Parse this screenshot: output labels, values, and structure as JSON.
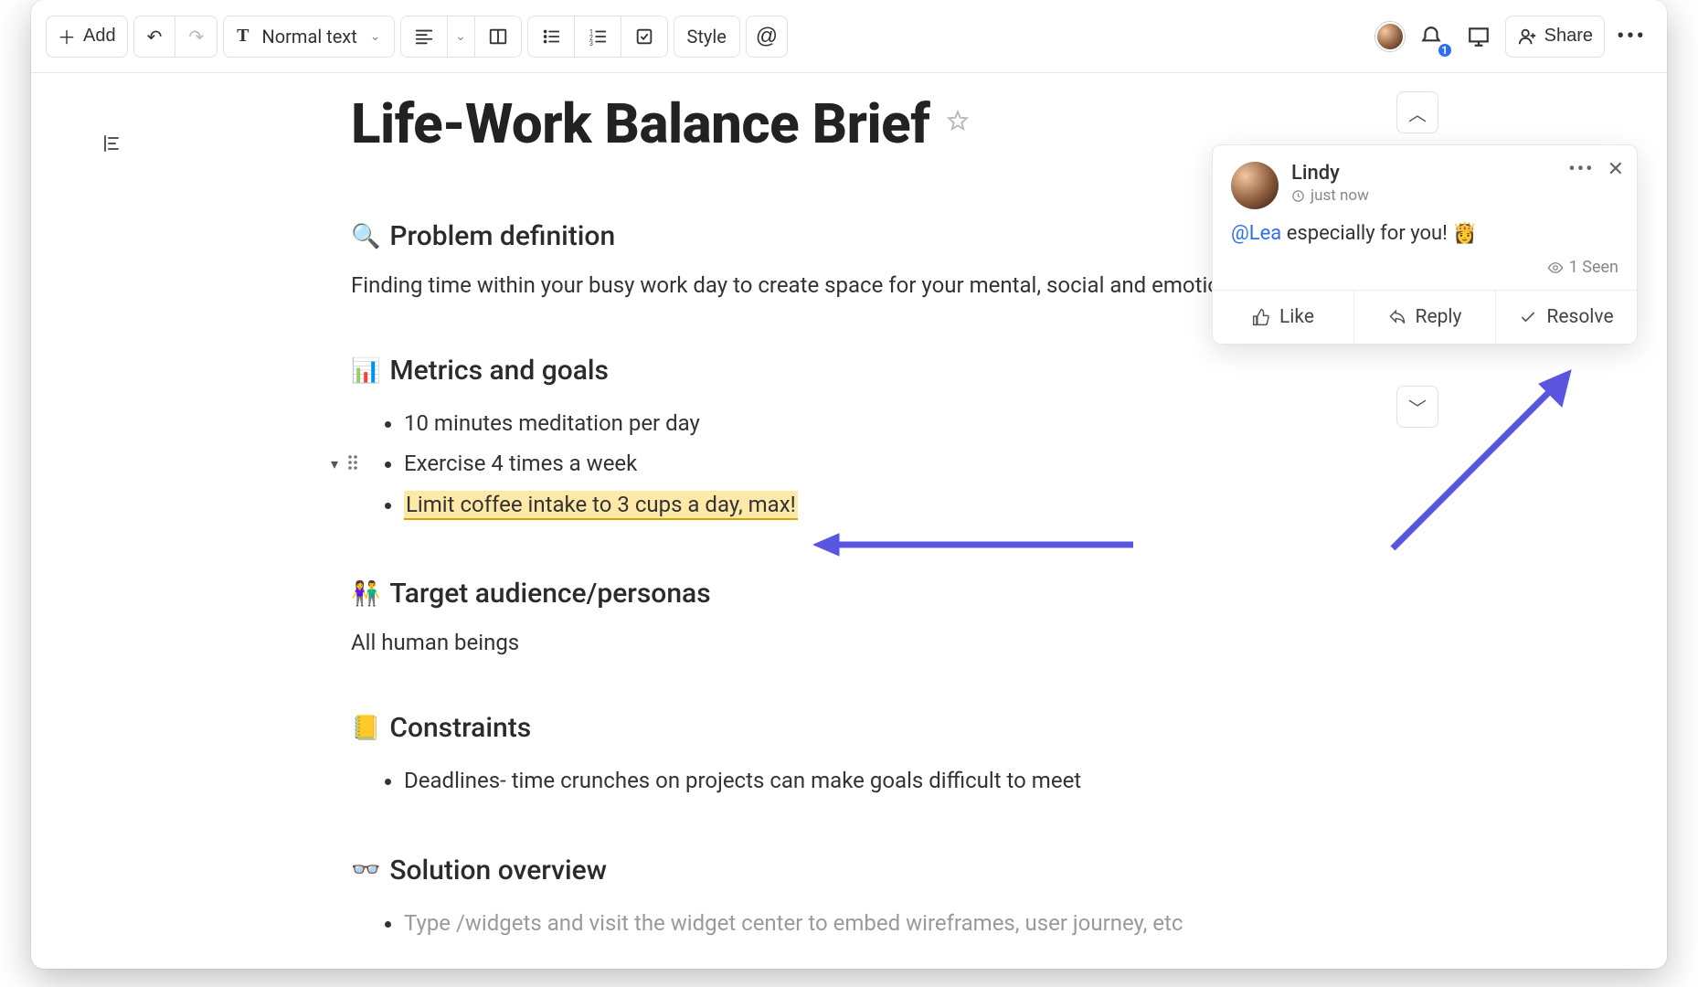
{
  "toolbar": {
    "add_label": "Add",
    "text_style_label": "Normal text",
    "style_label": "Style",
    "share_label": "Share",
    "notification_count": "1"
  },
  "document": {
    "title": "Life-Work Balance Brief",
    "sections": {
      "problem": {
        "icon": "🔍",
        "heading": "Problem definition",
        "body": "Finding time within your busy work day to create space for your mental, social and emotional w"
      },
      "metrics": {
        "icon": "📊",
        "heading": "Metrics and goals",
        "items": [
          "10 minutes meditation per day",
          "Exercise 4 times a week",
          "Limit coffee intake to 3 cups a day, max!"
        ]
      },
      "audience": {
        "icon": "👫",
        "heading": "Target audience/personas",
        "body": "All human beings"
      },
      "constraints": {
        "icon": "📒",
        "heading": "Constraints",
        "items": [
          "Deadlines- time crunches on projects can make goals difficult to meet"
        ]
      },
      "solution": {
        "icon": "👓",
        "heading": "Solution overview",
        "placeholder": "Type /widgets and visit the widget center to embed wireframes, user journey, etc"
      }
    }
  },
  "comment": {
    "author": "Lindy",
    "time": "just now",
    "mention": "@Lea",
    "text": " especially for you! ",
    "emoji": "👸",
    "seen_label": "1 Seen",
    "actions": {
      "like": "Like",
      "reply": "Reply",
      "resolve": "Resolve"
    }
  }
}
